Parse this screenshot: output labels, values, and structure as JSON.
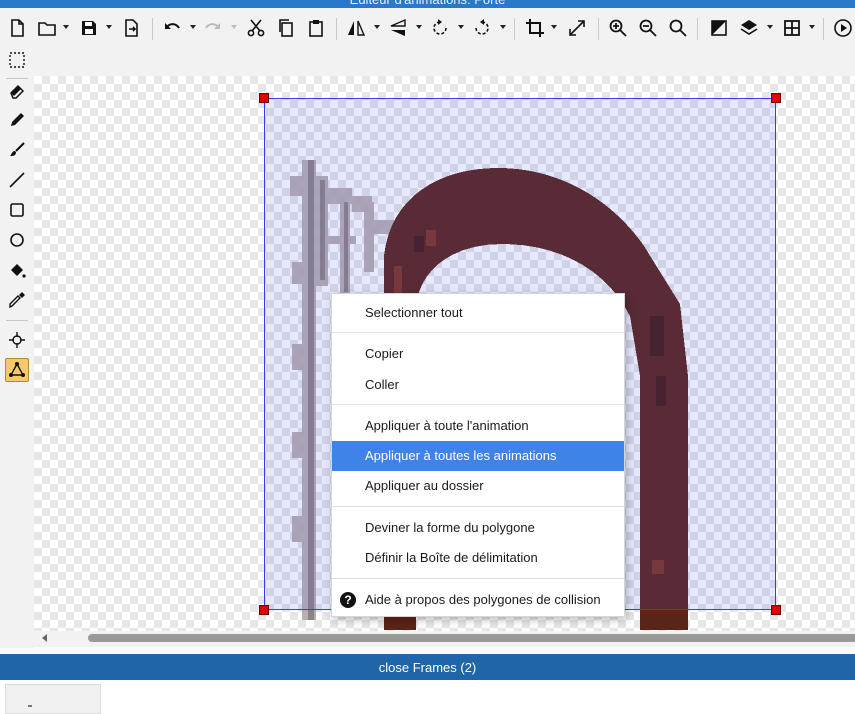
{
  "window": {
    "title": "Éditeur d'animations: Porte"
  },
  "toolbar": {
    "buttons": [
      "new-file-icon",
      "open-icon",
      "save-icon",
      "export-icon",
      "undo-icon",
      "redo-icon",
      "cut-icon",
      "copy-icon",
      "paste-icon",
      "flip-horizontal-icon",
      "flip-vertical-icon",
      "rotate-left-icon",
      "rotate-right-icon",
      "crop-icon",
      "resize-icon",
      "zoom-in-icon",
      "zoom-out-icon",
      "zoom-reset-icon",
      "transparency-icon",
      "layers-icon",
      "grid-icon",
      "play-icon"
    ]
  },
  "tools": [
    "selection-icon",
    "eraser-icon",
    "pencil-icon",
    "brush-icon",
    "line-icon",
    "rectangle-icon",
    "ellipse-icon",
    "fill-icon",
    "color-picker-icon",
    "origin-point-icon",
    "collision-polygon-icon"
  ],
  "context_menu": {
    "select_all": "Selectionner tout",
    "copy": "Copier",
    "paste": "Coller",
    "apply_animation": "Appliquer à toute l'animation",
    "apply_all_animations": "Appliquer à toutes les animations",
    "apply_folder": "Appliquer au dossier",
    "guess_polygon": "Deviner la forme du polygone",
    "define_bbox": "Définir la Boîte de délimitation",
    "help": "Aide à propos des polygones de collision"
  },
  "frames_panel": {
    "title": "close Frames (2)"
  },
  "colors": {
    "accent": "#2a79c9",
    "frames_bar": "#1e66a8",
    "highlight": "#3f82e8",
    "bbox": "#3a3af0",
    "handle": "#e00000",
    "door": "#5b2418"
  }
}
